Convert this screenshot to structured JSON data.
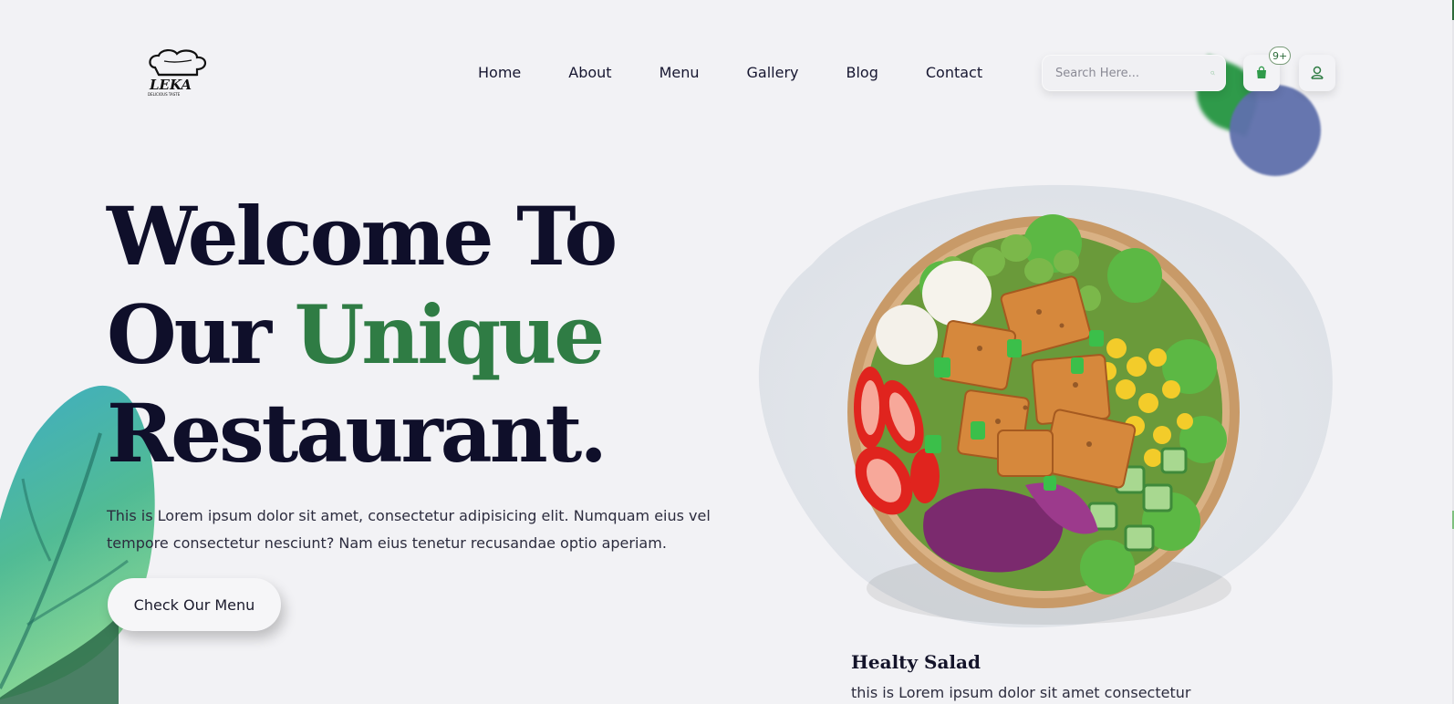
{
  "brand": {
    "name": "LEKA",
    "tagline": "DELICIOUS TASTE"
  },
  "nav": {
    "items": [
      "Home",
      "About",
      "Menu",
      "Gallery",
      "Blog",
      "Contact"
    ]
  },
  "search": {
    "placeholder": "Search Here..."
  },
  "cart": {
    "badge": "9+"
  },
  "hero": {
    "line1": "Welcome To",
    "line2_plain": "Our ",
    "line2_accent": "Unique",
    "line3": "Restaurant.",
    "description": "This is Lorem ipsum dolor sit amet, consectetur adipisicing elit. Numquam eius vel tempore consectetur nesciunt? Nam eius tenetur recusandae optio aperiam.",
    "cta_label": "Check Our Menu"
  },
  "featured": {
    "title": "Healty Salad",
    "description": "this is Lorem ipsum dolor sit amet consectetur"
  },
  "colors": {
    "accent": "#2f7c44",
    "heading": "#0f0f2a",
    "background": "#f2f2f5"
  }
}
